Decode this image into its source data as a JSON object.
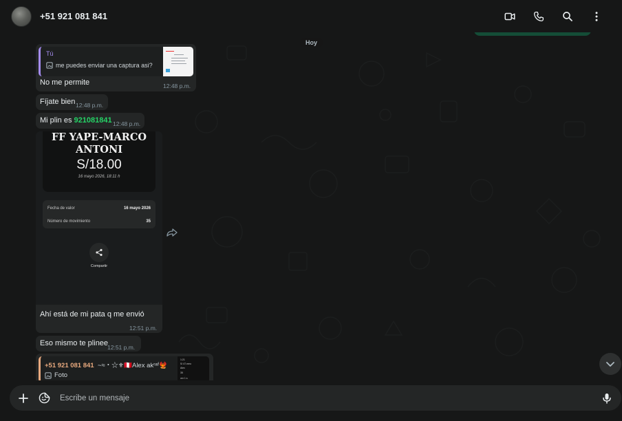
{
  "header": {
    "contact_name": "+51 921 081 841",
    "actions": [
      {
        "name": "video-call-icon"
      },
      {
        "name": "voice-call-icon"
      },
      {
        "name": "search-icon"
      },
      {
        "name": "menu-dots-icon"
      }
    ]
  },
  "chat": {
    "day_label": "Hoy",
    "messages": [
      {
        "quote_author": "Tú",
        "quote_text": "me puedes enviar una captura asi?",
        "text": "No me permite",
        "time": "12:48 p.m."
      },
      {
        "text": "Fíjate bien",
        "time": "12:48 p.m."
      },
      {
        "text_prefix": "Mi plin es ",
        "phone": "921081841",
        "time": "12:48 p.m."
      },
      {
        "image": {
          "name_line1": "FF YAPE-MARCO",
          "name_line2": "ANTONI",
          "amount": "S/18.00",
          "datetime": "16 mayo 2026, 18:11 h",
          "rows": [
            {
              "label": "Fecha de valor",
              "value": "16 mayo 2026"
            },
            {
              "label": "Número de movimiento",
              "value": "35"
            }
          ],
          "share_label": "Compartir"
        },
        "text": "Ahí está de mi pata q me envió",
        "time": "12:51 p.m."
      },
      {
        "text": "Eso mismo te plinee",
        "time": "12:51 p.m."
      },
      {
        "quote_author": "+51 921 081 841",
        "quote_author_extra": "~≈・☆⚜🇵🇪Alex akʳᵃᶠ🐦‍🔥",
        "quote_text": "Foto",
        "thumb_lines": [
          "1:21",
          "S/ 47.meo",
          "Alex",
          "35",
          "ver 1 s"
        ]
      }
    ]
  },
  "composer": {
    "placeholder": "Escribe un mensaje"
  },
  "colors": {
    "background": "#161717",
    "bubble_in": "#242626",
    "accent_green": "#25d366",
    "quote_purple": "#a58cf0",
    "quote_orange": "#e8a97e"
  }
}
